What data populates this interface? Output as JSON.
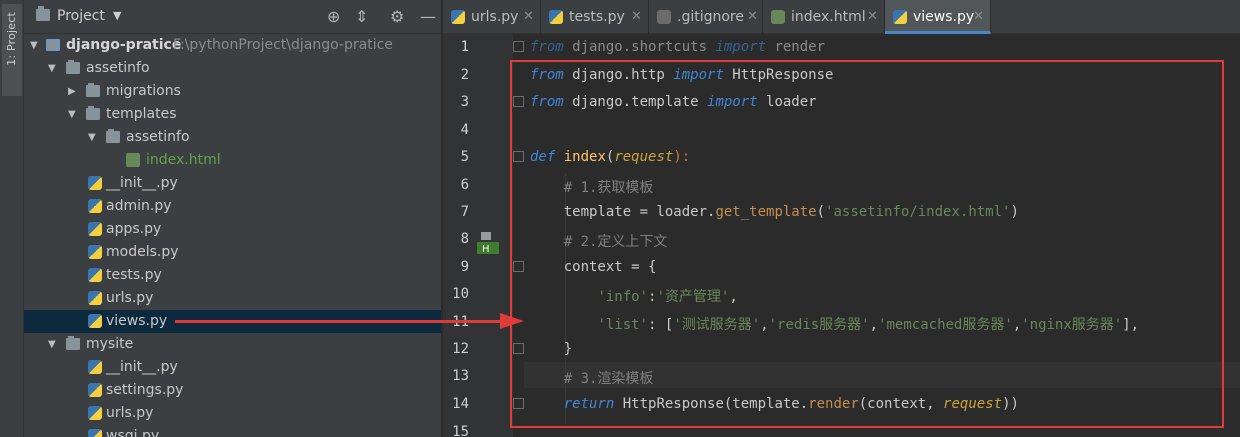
{
  "side_strip": {
    "label": "1: Project"
  },
  "project_panel": {
    "title": "Project",
    "tree": [
      {
        "label": "django-pratice",
        "path": "F:\\pythonProject\\django-pratice",
        "type": "folder",
        "depth": 0,
        "expanded": true
      },
      {
        "label": "assetinfo",
        "type": "folder",
        "depth": 1,
        "expanded": true
      },
      {
        "label": "migrations",
        "type": "folder",
        "depth": 2,
        "expanded": false
      },
      {
        "label": "templates",
        "type": "folder",
        "depth": 2,
        "expanded": true
      },
      {
        "label": "assetinfo",
        "type": "folder",
        "depth": 3,
        "expanded": true
      },
      {
        "label": "index.html",
        "type": "html",
        "depth": 4
      },
      {
        "label": "__init__.py",
        "type": "py",
        "depth": 2
      },
      {
        "label": "admin.py",
        "type": "py",
        "depth": 2
      },
      {
        "label": "apps.py",
        "type": "py",
        "depth": 2
      },
      {
        "label": "models.py",
        "type": "py",
        "depth": 2
      },
      {
        "label": "tests.py",
        "type": "py",
        "depth": 2
      },
      {
        "label": "urls.py",
        "type": "py",
        "depth": 2
      },
      {
        "label": "views.py",
        "type": "py",
        "depth": 2,
        "selected": true
      },
      {
        "label": "mysite",
        "type": "folder",
        "depth": 1,
        "expanded": true
      },
      {
        "label": "__init__.py",
        "type": "py",
        "depth": 2
      },
      {
        "label": "settings.py",
        "type": "py",
        "depth": 2
      },
      {
        "label": "urls.py",
        "type": "py",
        "depth": 2
      },
      {
        "label": "wsgi.py",
        "type": "py",
        "depth": 2
      }
    ]
  },
  "tabs": [
    {
      "label": "urls.py",
      "icon": "python-file-icon",
      "active": false
    },
    {
      "label": "tests.py",
      "icon": "python-file-icon",
      "active": false
    },
    {
      "label": ".gitignore",
      "icon": "gitignore-file-icon",
      "active": false
    },
    {
      "label": "index.html",
      "icon": "html-file-icon",
      "active": false
    },
    {
      "label": "views.py",
      "icon": "python-file-icon",
      "active": true
    }
  ],
  "line_numbers": [
    "1",
    "2",
    "3",
    "4",
    "5",
    "6",
    "7",
    "8",
    "9",
    "10",
    "11",
    "12",
    "13",
    "14",
    "15"
  ],
  "code": {
    "l1_from": "from",
    "l1_mod": " django.shortcuts ",
    "l1_import": "import",
    "l1_name": " render",
    "l2_from": "from",
    "l2_mod": " django.http ",
    "l2_import": "import",
    "l2_name": " HttpResponse",
    "l3_from": "from",
    "l3_mod": " django.template ",
    "l3_import": "import",
    "l3_name": " loader",
    "l5_def": "def",
    "l5_fn": " index",
    "l5_open": "(",
    "l5_param": "request",
    "l5_close": "):",
    "l6_comment": "    # 1.获取模板",
    "l7_a": "    template = loader.",
    "l7_meth": "get_template",
    "l7_open": "(",
    "l7_str": "'assetinfo/index.html'",
    "l7_close": ")",
    "l8_comment": "    # 2.定义上下文",
    "l9_text": "    context = {",
    "l10_indent": "        ",
    "l10_key": "'info'",
    "l10_colon": ":",
    "l10_val": "'资产管理'",
    "l10_comma": ",",
    "l11_indent": "        ",
    "l11_key": "'list'",
    "l11_colon": ": [",
    "l11_v1": "'测试服务器'",
    "l11_c1": ",",
    "l11_v2": "'redis服务器'",
    "l11_c2": ",",
    "l11_v3": "'memcached服务器'",
    "l11_c3": ",",
    "l11_v4": "'nginx服务器'",
    "l11_end": "],",
    "l12_text": "    }",
    "l13_comment": "    # 3.渲染模板",
    "l14_indent": "    ",
    "l14_ret": "return",
    "l14_a": " HttpResponse(template.",
    "l14_meth": "render",
    "l14_b": "(context, ",
    "l14_param": "request",
    "l14_c": "))"
  },
  "colors": {
    "annotation": "#e23b3b",
    "selection": "#0d293e",
    "active_tab_underline": "#4a88c7"
  }
}
